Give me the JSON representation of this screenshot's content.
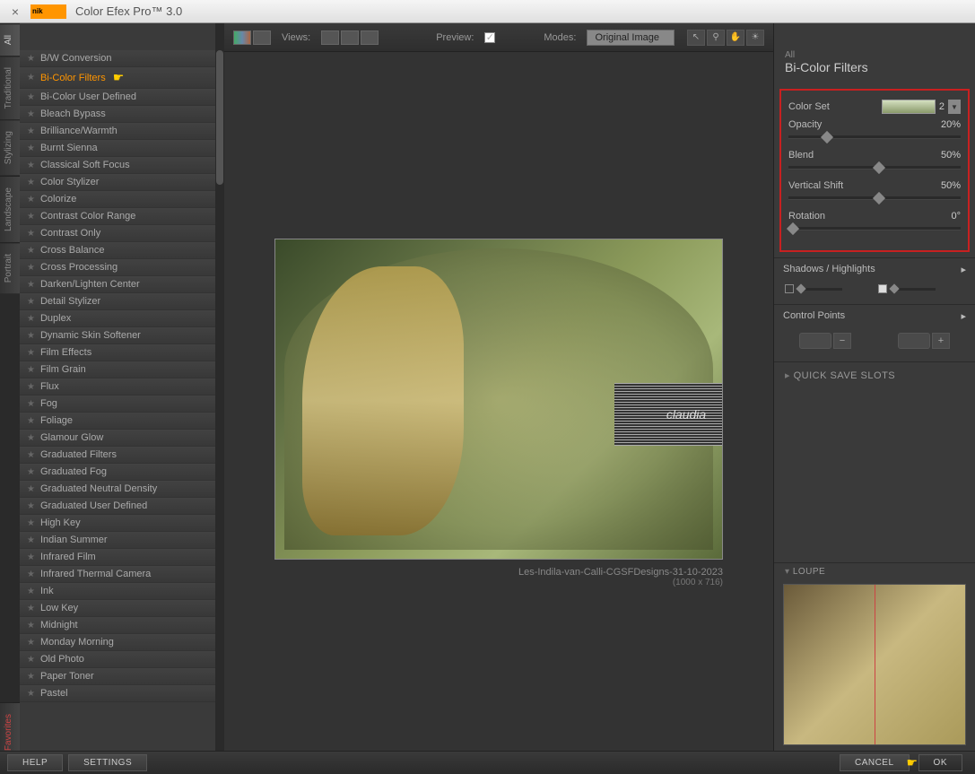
{
  "titlebar": {
    "logo_text": "nik",
    "title": "Color Efex Pro™ 3.0"
  },
  "vtabs": [
    "All",
    "Traditional",
    "Stylizing",
    "Landscape",
    "Portrait"
  ],
  "favorites_tab": "Favorites",
  "filters": [
    "B/W Conversion",
    "Bi-Color Filters",
    "Bi-Color User Defined",
    "Bleach Bypass",
    "Brilliance/Warmth",
    "Burnt Sienna",
    "Classical Soft Focus",
    "Color Stylizer",
    "Colorize",
    "Contrast Color Range",
    "Contrast Only",
    "Cross Balance",
    "Cross Processing",
    "Darken/Lighten Center",
    "Detail Stylizer",
    "Duplex",
    "Dynamic Skin Softener",
    "Film Effects",
    "Film Grain",
    "Flux",
    "Fog",
    "Foliage",
    "Glamour Glow",
    "Graduated Filters",
    "Graduated Fog",
    "Graduated Neutral Density",
    "Graduated User Defined",
    "High Key",
    "Indian Summer",
    "Infrared Film",
    "Infrared Thermal Camera",
    "Ink",
    "Low Key",
    "Midnight",
    "Monday Morning",
    "Old Photo",
    "Paper Toner",
    "Pastel"
  ],
  "selected_filter_index": 1,
  "toolbar": {
    "views": "Views:",
    "preview": "Preview:",
    "modes": "Modes:",
    "mode_value": "Original Image"
  },
  "canvas": {
    "caption": "Les-Indila-van-Calli-CGSFDesigns-31-10-2023",
    "dimensions": "(1000 x 716)",
    "watermark": "claudia"
  },
  "right": {
    "all": "All",
    "title": "Bi-Color Filters",
    "settings": [
      {
        "label": "Color Set",
        "value": "2",
        "type": "swatch"
      },
      {
        "label": "Opacity",
        "value": "20%",
        "thumb": 20
      },
      {
        "label": "Blend",
        "value": "50%",
        "thumb": 50
      },
      {
        "label": "Vertical Shift",
        "value": "50%",
        "thumb": 50
      },
      {
        "label": "Rotation",
        "value": "0°",
        "thumb": 0
      }
    ],
    "shadows": "Shadows / Highlights",
    "control_points": "Control Points",
    "qss": "QUICK SAVE SLOTS",
    "loupe": "LOUPE"
  },
  "footer": {
    "help": "HELP",
    "settings": "SETTINGS",
    "cancel": "CANCEL",
    "ok": "OK"
  }
}
